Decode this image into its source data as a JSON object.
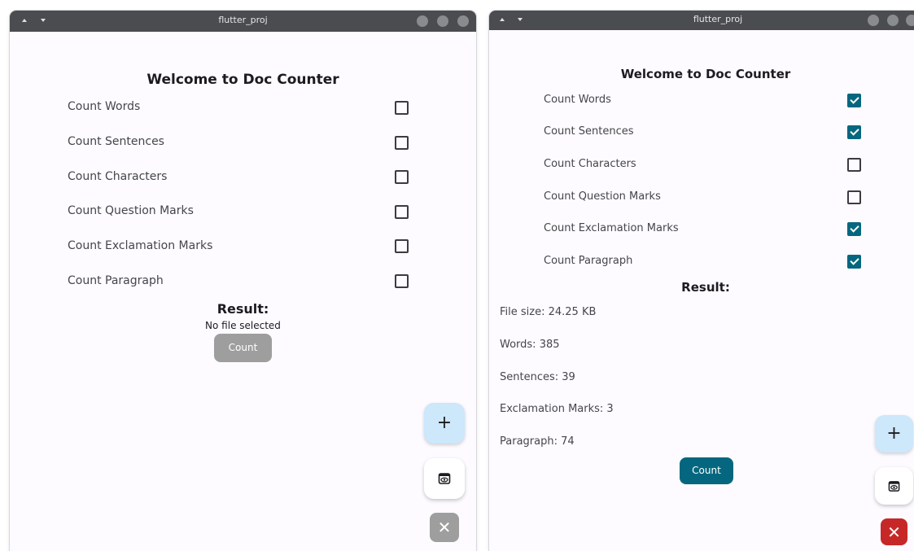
{
  "left_window": {
    "title": "flutter_proj",
    "heading": "Welcome to Doc Counter",
    "options": [
      {
        "label": "Count Words",
        "checked": false
      },
      {
        "label": "Count Sentences",
        "checked": false
      },
      {
        "label": "Count Characters",
        "checked": false
      },
      {
        "label": "Count Question Marks",
        "checked": false
      },
      {
        "label": "Count Exclamation Marks",
        "checked": false
      },
      {
        "label": "Count Paragraph",
        "checked": false
      }
    ],
    "result_title": "Result:",
    "status": "No file selected",
    "count_button": "Count",
    "count_enabled": false,
    "add_icon": "plus-icon",
    "preview_icon": "eye-icon",
    "close_icon": "close-icon",
    "close_enabled": false
  },
  "right_window": {
    "title": "flutter_proj",
    "heading": "Welcome to Doc Counter",
    "options": [
      {
        "label": "Count Words",
        "checked": true
      },
      {
        "label": "Count Sentences",
        "checked": true
      },
      {
        "label": "Count Characters",
        "checked": false
      },
      {
        "label": "Count Question Marks",
        "checked": false
      },
      {
        "label": "Count Exclamation Marks",
        "checked": true
      },
      {
        "label": "Count Paragraph",
        "checked": true
      }
    ],
    "result_title": "Result:",
    "results": [
      "File size: 24.25 KB",
      "Words: 385",
      "Sentences: 39",
      "Exclamation Marks: 3",
      "Paragraph: 74"
    ],
    "count_button": "Count",
    "count_enabled": true,
    "add_icon": "plus-icon",
    "preview_icon": "eye-icon",
    "close_icon": "close-icon",
    "close_enabled": true
  },
  "colors": {
    "accent": "#05677f",
    "disabled": "#9e9e9e",
    "danger": "#c62828",
    "fab_add_bg": "#cde7fb"
  }
}
